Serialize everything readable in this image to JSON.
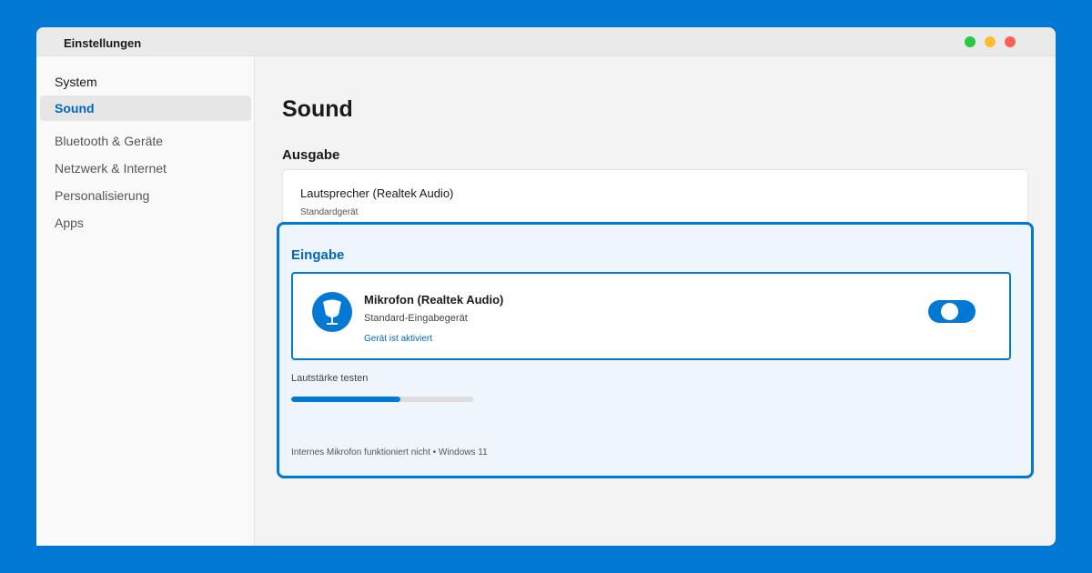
{
  "window": {
    "title": "Einstellungen"
  },
  "sidebar": {
    "items": [
      {
        "label": "System"
      },
      {
        "label": "Sound"
      },
      {
        "label": "Bluetooth & Geräte"
      },
      {
        "label": "Netzwerk & Internet"
      },
      {
        "label": "Personalisierung"
      },
      {
        "label": "Apps"
      }
    ],
    "active_index": 1
  },
  "main": {
    "title": "Sound",
    "output": {
      "heading": "Ausgabe",
      "device_name": "Lautsprecher (Realtek Audio)",
      "device_subtitle": "Standardgerät"
    },
    "input": {
      "heading": "Eingabe",
      "device_name": "Mikrofon (Realtek Audio)",
      "device_subtitle": "Standard-Eingabegerät",
      "device_status": "Gerät ist aktiviert",
      "device_icon": "microphone-icon",
      "toggle_on": true,
      "volume_label": "Lautstärke testen",
      "volume_level": 0.6,
      "footer_note": "Internes Mikrofon funktioniert nicht • Windows 11"
    }
  },
  "colors": {
    "accent": "#0078d4",
    "accent_text": "#0067c0",
    "background": "#0078d4"
  }
}
